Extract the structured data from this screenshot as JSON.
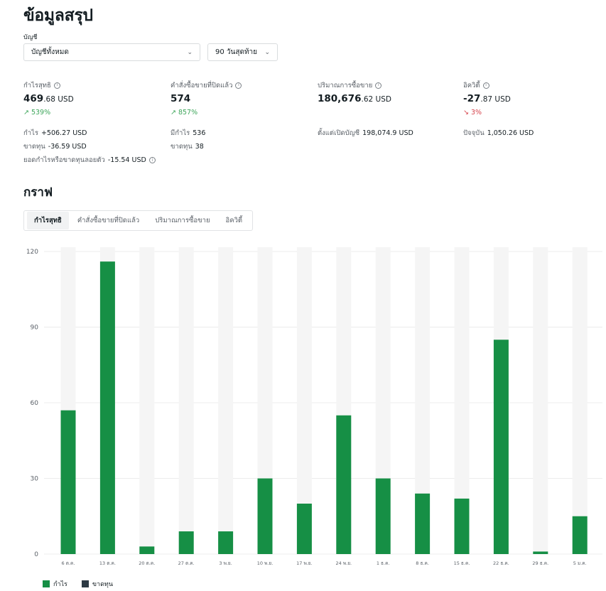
{
  "page": {
    "title": "ข้อมูลสรุป"
  },
  "filters": {
    "account_label": "บัญชี",
    "account_value": "บัญชีทั้งหมด",
    "period_value": "90 วันสุดท้าย"
  },
  "metrics": [
    {
      "label": "กำไรสุทธิ",
      "value_main": "469",
      "value_dec": ".68",
      "currency": " USD",
      "change": "539%",
      "trend": "up"
    },
    {
      "label": "คำสั่งซื้อขายที่ปิดแล้ว",
      "value_main": "574",
      "value_dec": "",
      "currency": "",
      "change": "857%",
      "trend": "up"
    },
    {
      "label": "ปริมาณการซื้อขาย",
      "value_main": "180,676",
      "value_dec": ".62",
      "currency": " USD",
      "change": "",
      "trend": ""
    },
    {
      "label": "อิควิตี้",
      "value_main": "-27",
      "value_dec": ".87",
      "currency": " USD",
      "change": "3%",
      "trend": "down"
    }
  ],
  "details": {
    "profit_key": "กำไร",
    "profit_val": "+506.27 USD",
    "loss_key": "ขาดทุน",
    "loss_val": "-36.59 USD",
    "floating_key": "ยอดกำไรหรือขาดทุนลอยตัว",
    "floating_val": "-15.54 USD",
    "profitable_key": "มีกำไร",
    "profitable_val": "536",
    "losing_key": "ขาดทุน",
    "losing_val": "38",
    "since_open_key": "ตั้งแต่เปิดบัญชี",
    "since_open_val": "198,074.9 USD",
    "current_key": "ปัจจุบัน",
    "current_val": "1,050.26 USD"
  },
  "graph": {
    "section_title": "กราฟ",
    "tabs": [
      "กำไรสุทธิ",
      "คำสั่งซื้อขายที่ปิดแล้ว",
      "ปริมาณการซื้อขาย",
      "อิควิตี้"
    ],
    "active_tab": 0
  },
  "chart_data": {
    "type": "bar",
    "categories": [
      "6 ต.ค.",
      "13 ต.ค.",
      "20 ต.ค.",
      "27 ต.ค.",
      "3 พ.ย.",
      "10 พ.ย.",
      "17 พ.ย.",
      "24 พ.ย.",
      "1 ธ.ค.",
      "8 ธ.ค.",
      "15 ธ.ค.",
      "22 ธ.ค.",
      "29 ธ.ค.",
      "5 ม.ค."
    ],
    "series": [
      {
        "name": "กำไร",
        "color": "#168f45",
        "values": [
          57,
          116,
          3,
          9,
          9,
          30,
          20,
          55,
          30,
          24,
          22,
          85,
          1,
          15
        ]
      },
      {
        "name": "ขาดทุน",
        "color": "#2c3943",
        "values": [
          0,
          0,
          0,
          0,
          0,
          0,
          0,
          0,
          0,
          0,
          0,
          0,
          0,
          0
        ]
      }
    ],
    "ylim": [
      0,
      120
    ],
    "yticks": [
      0,
      30,
      60,
      90,
      120
    ],
    "grid": true,
    "background_bar_color": "#f5f5f5",
    "legend_position": "bottom-left"
  }
}
